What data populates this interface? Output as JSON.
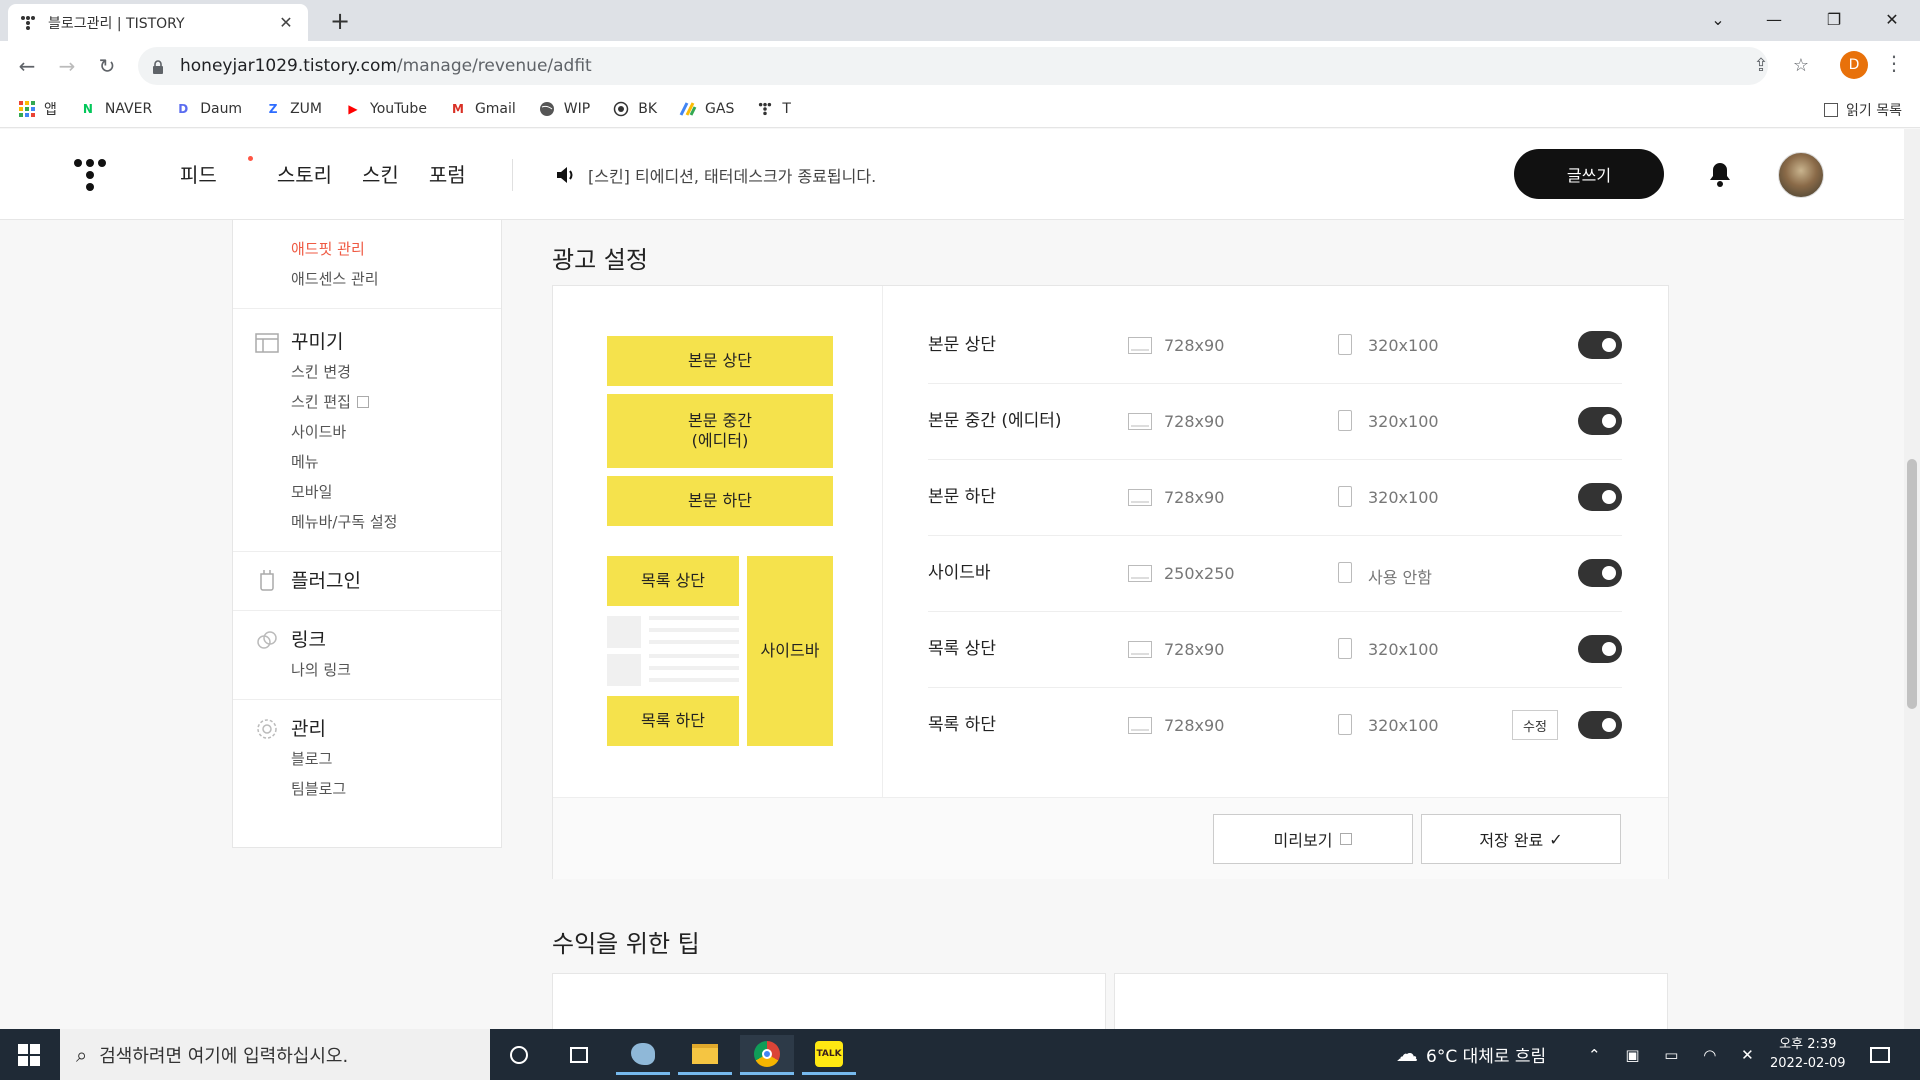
{
  "browser": {
    "tab_title": "블로그관리 | TISTORY",
    "tab_close": "✕",
    "new_tab": "+",
    "url_host": "honeyjar1029.tistory.com",
    "url_path": "/manage/revenue/adfit",
    "profile_initial": "D",
    "bookmarks": [
      {
        "label": "앱",
        "icon": "apps-grid-icon"
      },
      {
        "label": "NAVER",
        "icon": "naver-icon",
        "mark": "N",
        "color": "#03c75a"
      },
      {
        "label": "Daum",
        "icon": "daum-icon",
        "mark": "D",
        "color": "#5a6cf0"
      },
      {
        "label": "ZUM",
        "icon": "zum-icon",
        "mark": "Z",
        "color": "#2d6cff"
      },
      {
        "label": "YouTube",
        "icon": "youtube-icon",
        "mark": "▶",
        "color": "#ff0000"
      },
      {
        "label": "Gmail",
        "icon": "gmail-icon",
        "mark": "M",
        "color": "#d93025"
      },
      {
        "label": "WIP",
        "icon": "globe-icon"
      },
      {
        "label": "BK",
        "icon": "target-icon"
      },
      {
        "label": "GAS",
        "icon": "apps-script-icon"
      },
      {
        "label": "T",
        "icon": "tistory-icon"
      }
    ],
    "reading_list": "읽기 목록"
  },
  "header": {
    "menu": [
      "피드",
      "스토리",
      "스킨",
      "포럼"
    ],
    "notice": "[스킨] 티에디션, 태터데스크가 종료됩니다.",
    "write_label": "글쓰기"
  },
  "sidebar": {
    "revenue_items": [
      "애드핏 관리",
      "애드센스 관리"
    ],
    "sections": [
      {
        "title": "꾸미기",
        "items": [
          "스킨 변경",
          "스킨 편집",
          "사이드바",
          "메뉴",
          "모바일",
          "메뉴바/구독 설정"
        ]
      },
      {
        "title": "플러그인",
        "items": []
      },
      {
        "title": "링크",
        "items": [
          "나의 링크"
        ]
      },
      {
        "title": "관리",
        "items": [
          "블로그",
          "팀블로그"
        ]
      }
    ]
  },
  "ad_settings": {
    "title": "광고 설정",
    "preview": {
      "top": "본문 상단",
      "middle_1": "본문 중간",
      "middle_2": "(에디터)",
      "bottom": "본문 하단",
      "list_top": "목록 상단",
      "list_bottom": "목록 하단",
      "sidebar": "사이드바"
    },
    "rows": [
      {
        "name": "본문 상단",
        "pc": "728x90",
        "mobile": "320x100",
        "on": true
      },
      {
        "name": "본문 중간 (에디터)",
        "pc": "728x90",
        "mobile": "320x100",
        "on": true
      },
      {
        "name": "본문 하단",
        "pc": "728x90",
        "mobile": "320x100",
        "on": true
      },
      {
        "name": "사이드바",
        "pc": "250x250",
        "mobile": "사용 안함",
        "on": true
      },
      {
        "name": "목록 상단",
        "pc": "728x90",
        "mobile": "320x100",
        "on": true
      },
      {
        "name": "목록 하단",
        "pc": "728x90",
        "mobile": "320x100",
        "on": true,
        "edit": "수정"
      }
    ],
    "preview_button": "미리보기",
    "save_button": "저장 완료"
  },
  "tips": {
    "title": "수익을 위한 팁"
  },
  "taskbar": {
    "search_placeholder": "검색하려면 여기에 입력하십시오.",
    "weather": "6°C  대체로 흐림",
    "time": "오후 2:39",
    "date": "2022-02-09"
  },
  "colors": {
    "accent": "#ef5a43",
    "ad_yellow": "#f5e24c",
    "toggle": "#333333"
  }
}
